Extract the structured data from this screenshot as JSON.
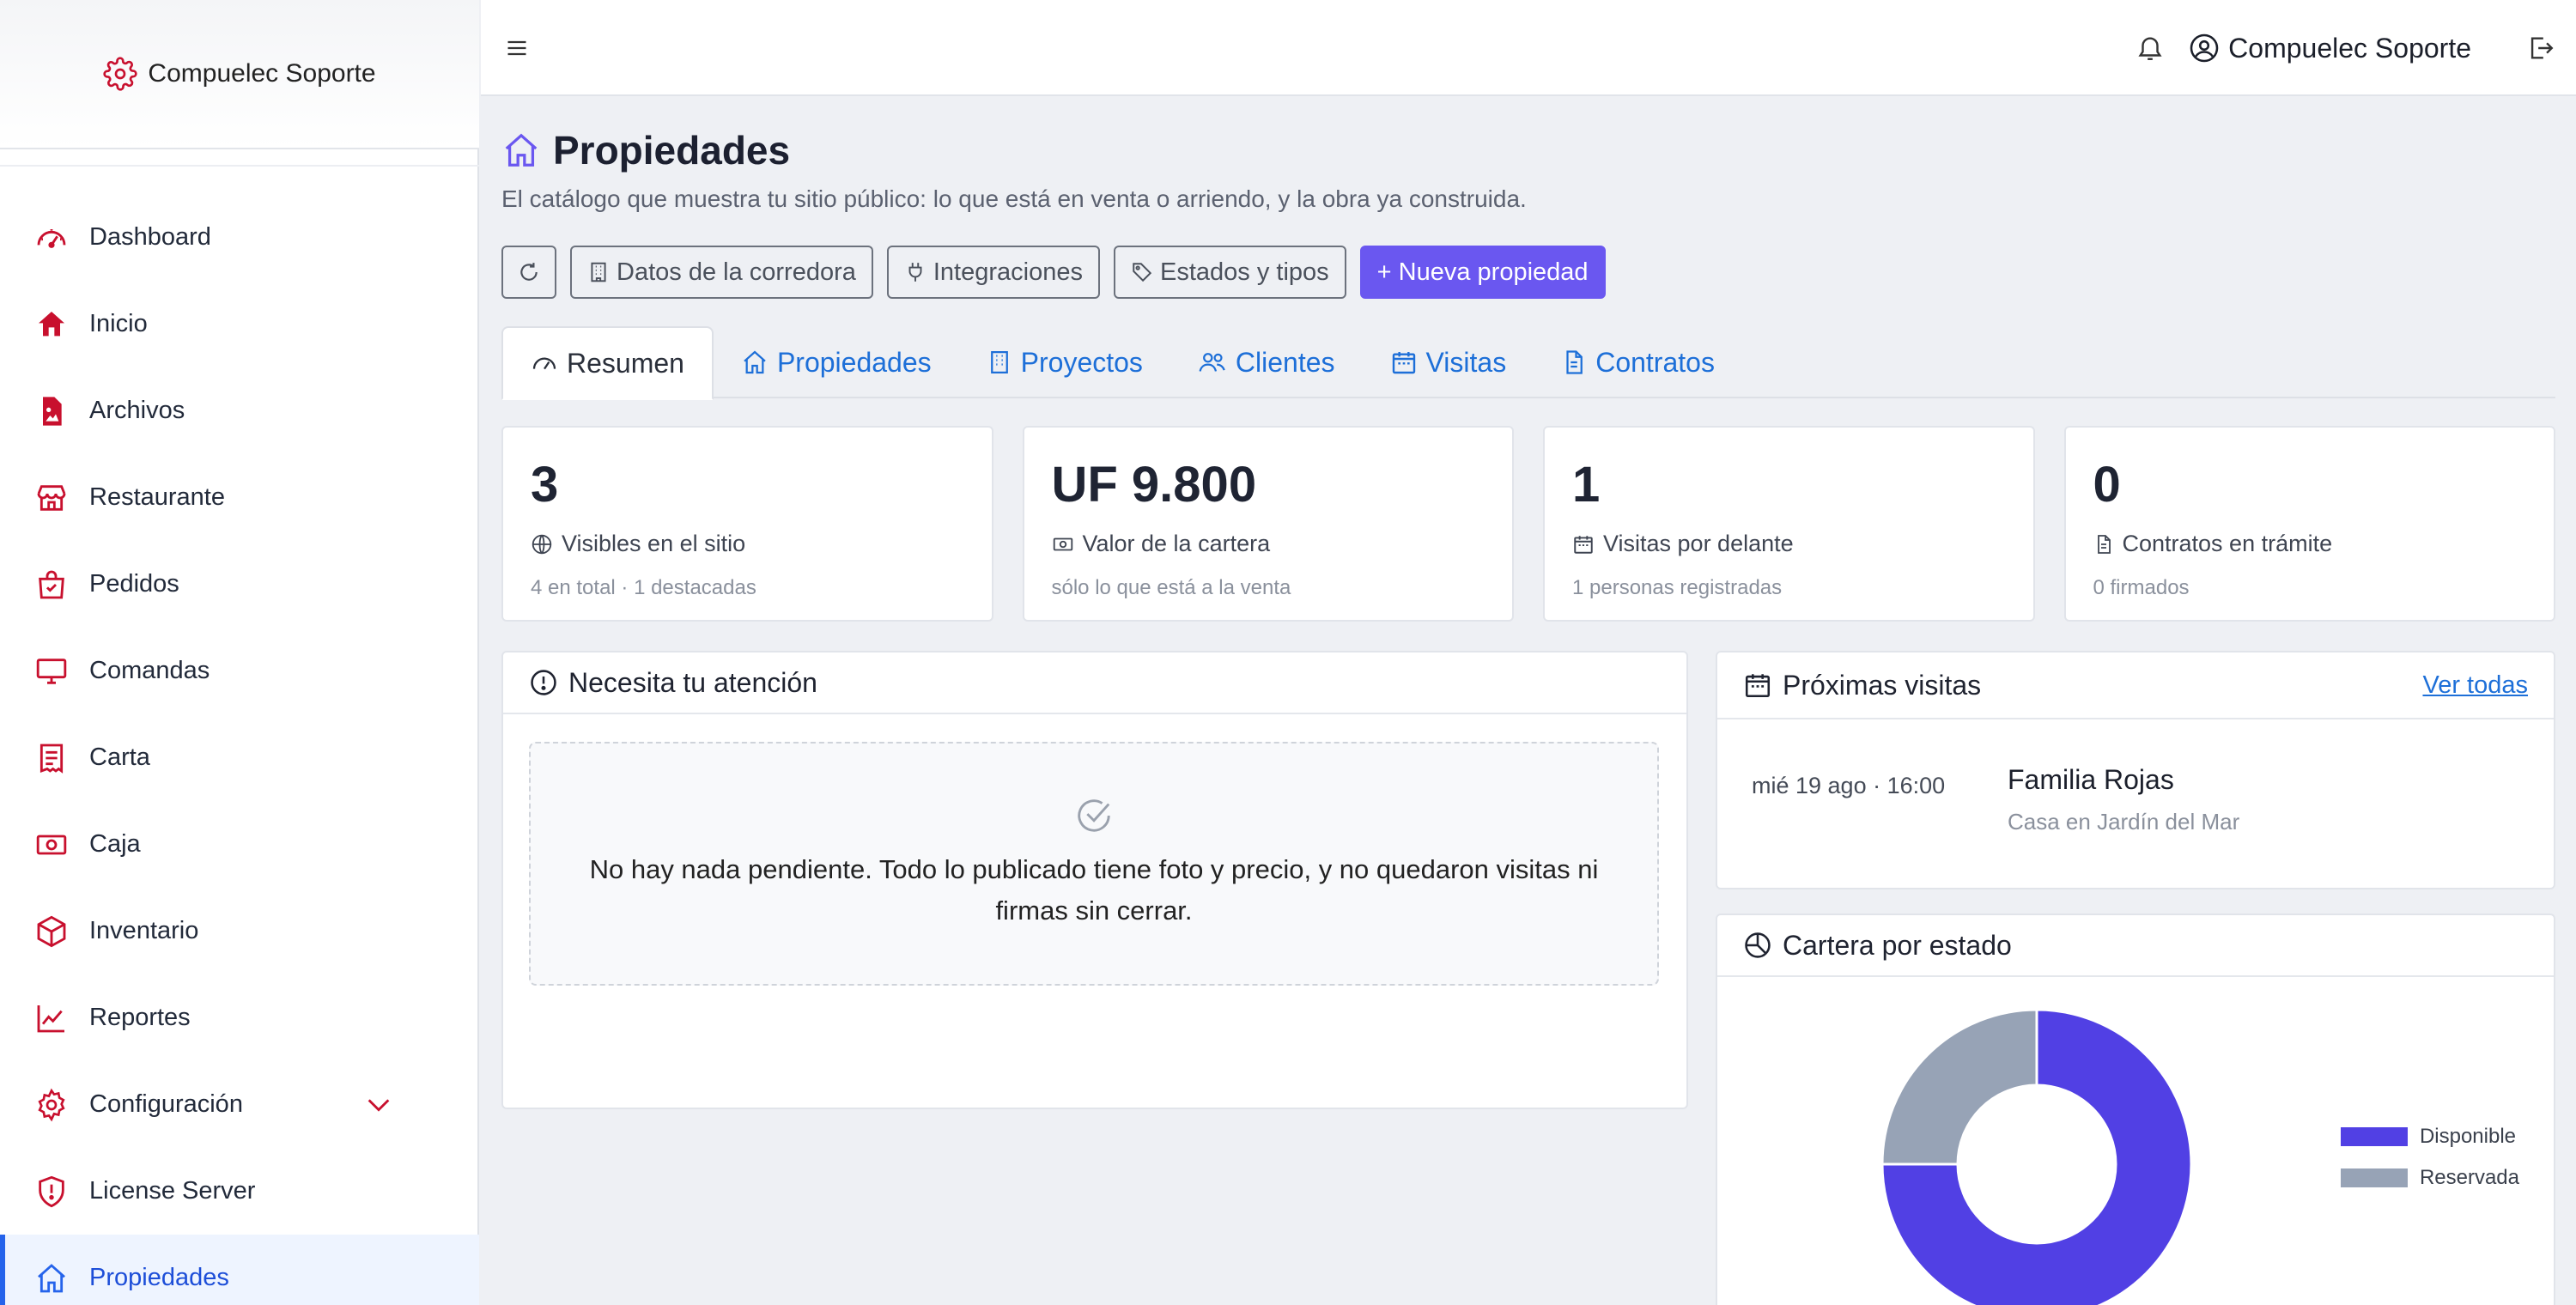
{
  "brand": {
    "name": "Compuelec Soporte"
  },
  "topbar": {
    "user_name": "Compuelec Soporte"
  },
  "sidebar": {
    "items": [
      {
        "label": "Dashboard"
      },
      {
        "label": "Inicio"
      },
      {
        "label": "Archivos"
      },
      {
        "label": "Restaurante"
      },
      {
        "label": "Pedidos"
      },
      {
        "label": "Comandas"
      },
      {
        "label": "Carta"
      },
      {
        "label": "Caja"
      },
      {
        "label": "Inventario"
      },
      {
        "label": "Reportes"
      },
      {
        "label": "Configuración"
      },
      {
        "label": "License Server"
      },
      {
        "label": "Propiedades"
      }
    ]
  },
  "page": {
    "title": "Propiedades",
    "subtitle": "El catálogo que muestra tu sitio público: lo que está en venta o arriendo, y la obra ya construida."
  },
  "actions": {
    "broker_data": "Datos de la corredora",
    "integrations": "Integraciones",
    "states_types": "Estados y tipos",
    "new_property": "+ Nueva propiedad"
  },
  "tabs": [
    {
      "label": "Resumen"
    },
    {
      "label": "Propiedades"
    },
    {
      "label": "Proyectos"
    },
    {
      "label": "Clientes"
    },
    {
      "label": "Visitas"
    },
    {
      "label": "Contratos"
    }
  ],
  "stats": [
    {
      "value": "3",
      "label": "Visibles en el sitio",
      "sub": "4 en total · 1 destacadas"
    },
    {
      "value": "UF 9.800",
      "label": "Valor de la cartera",
      "sub": "sólo lo que está a la venta"
    },
    {
      "value": "1",
      "label": "Visitas por delante",
      "sub": "1 personas registradas"
    },
    {
      "value": "0",
      "label": "Contratos en trámite",
      "sub": "0 firmados"
    }
  ],
  "attention": {
    "title": "Necesita tu atención",
    "empty_message": "No hay nada pendiente. Todo lo publicado tiene foto y precio, y no quedaron visitas ni firmas sin cerrar."
  },
  "visits": {
    "title": "Próximas visitas",
    "see_all": "Ver todas",
    "items": [
      {
        "date": "mié 19 ago · 16:00",
        "name": "Familia Rojas",
        "place": "Casa en Jardín del Mar"
      }
    ]
  },
  "portfolio": {
    "title": "Cartera por estado"
  },
  "colors": {
    "accent": "#6a57f0",
    "sidebar_icon": "#c8102e",
    "link": "#1d6fd8",
    "donut_disponible": "#5140e4",
    "donut_reservada": "#97a3b6"
  },
  "chart_data": {
    "type": "pie",
    "categories": [
      "Disponible",
      "Reservada"
    ],
    "values": [
      3,
      1
    ],
    "legend": "right"
  }
}
